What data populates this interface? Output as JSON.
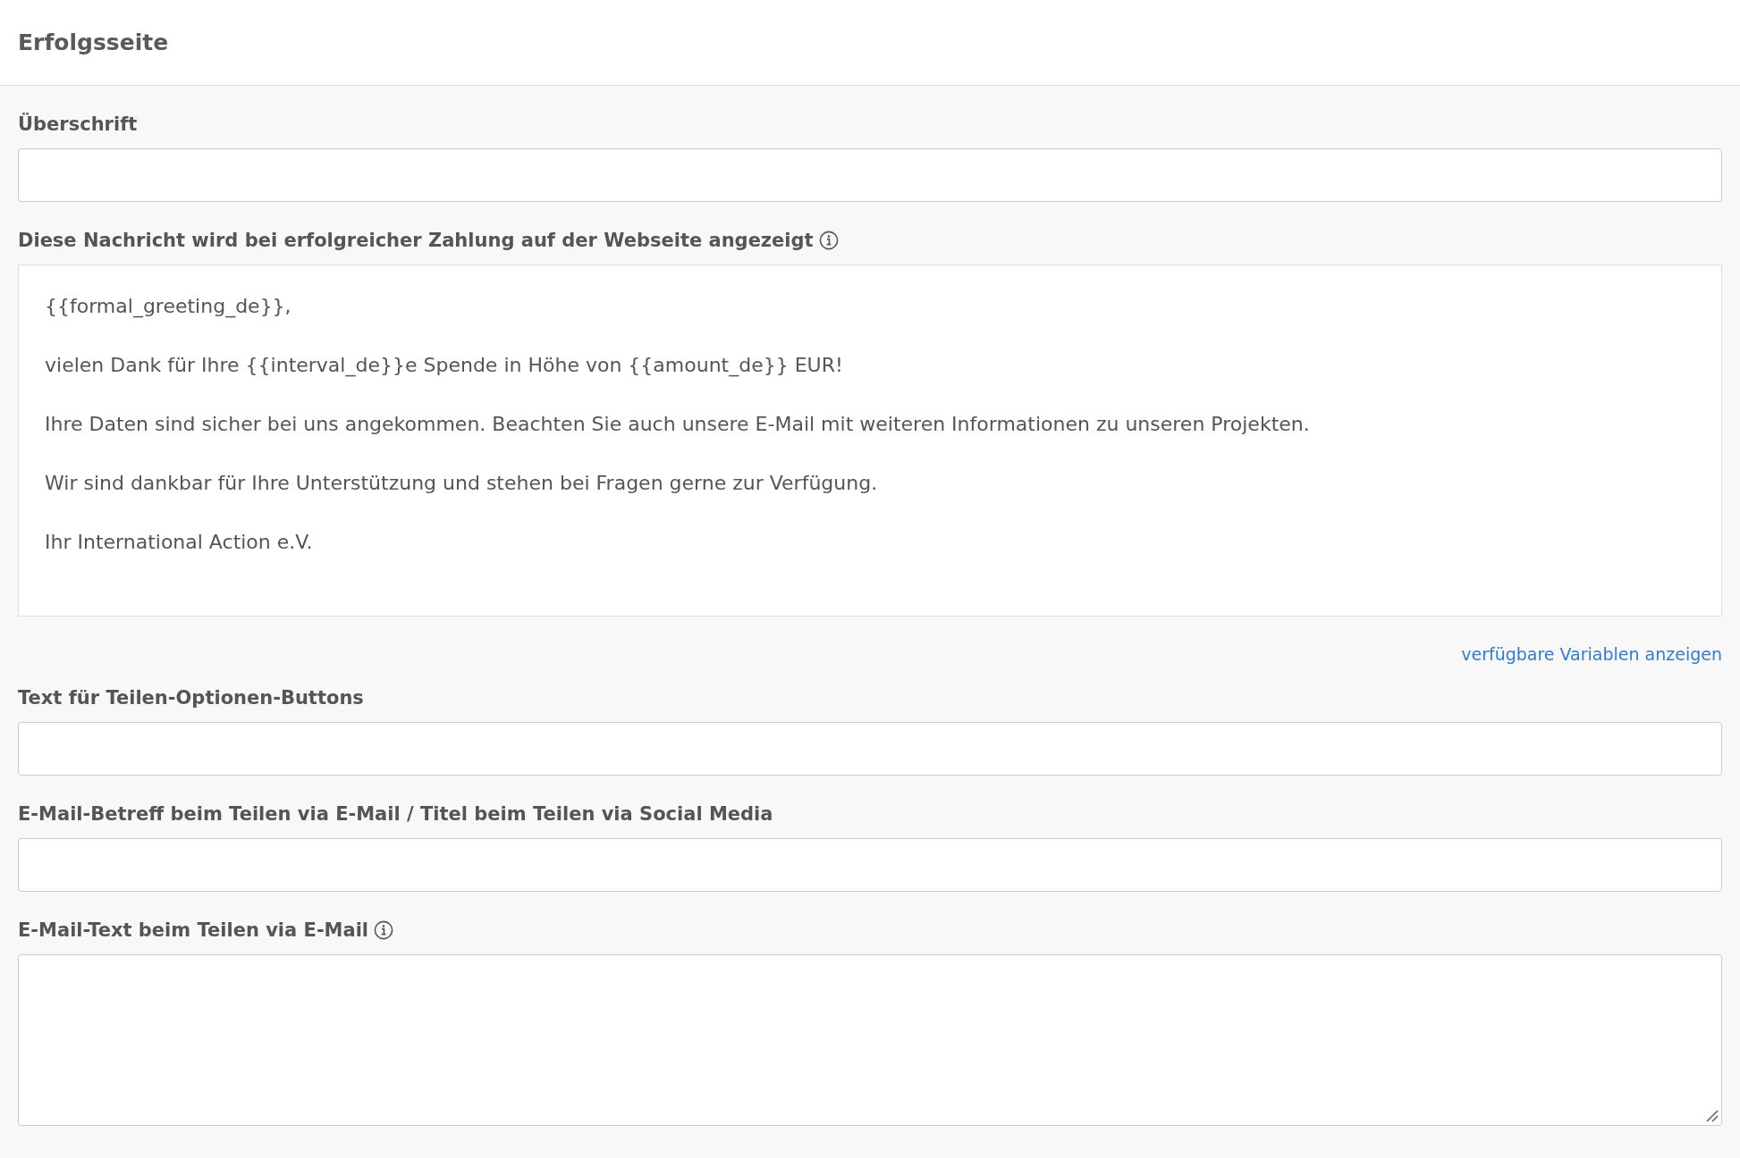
{
  "header": {
    "title": "Erfolgsseite"
  },
  "fields": [
    {
      "kind": "input",
      "label": "Überschrift",
      "info": false
    },
    {
      "kind": "richtext",
      "label": "Diese Nachricht wird bei erfolgreicher Zahlung auf der Webseite angezeigt",
      "info": true,
      "paragraphs": [
        "{{formal_greeting_de}},",
        "vielen Dank für Ihre {{interval_de}}e Spende in Höhe von {{amount_de}} EUR!",
        "Ihre Daten sind sicher bei uns angekommen. Beachten Sie auch unsere E-Mail mit weiteren Informationen zu unseren Projekten.",
        "Wir sind dankbar für Ihre Unterstützung und stehen bei Fragen gerne zur Verfügung.",
        "Ihr International Action e.V."
      ],
      "link": "verfügbare Variablen anzeigen"
    },
    {
      "kind": "input",
      "label": "Text für Teilen-Optionen-Buttons",
      "info": false
    },
    {
      "kind": "input",
      "label": "E-Mail-Betreff beim Teilen via E-Mail / Titel beim Teilen via Social Media",
      "info": false
    },
    {
      "kind": "textarea",
      "label": "E-Mail-Text beim Teilen via E-Mail",
      "info": true
    }
  ]
}
